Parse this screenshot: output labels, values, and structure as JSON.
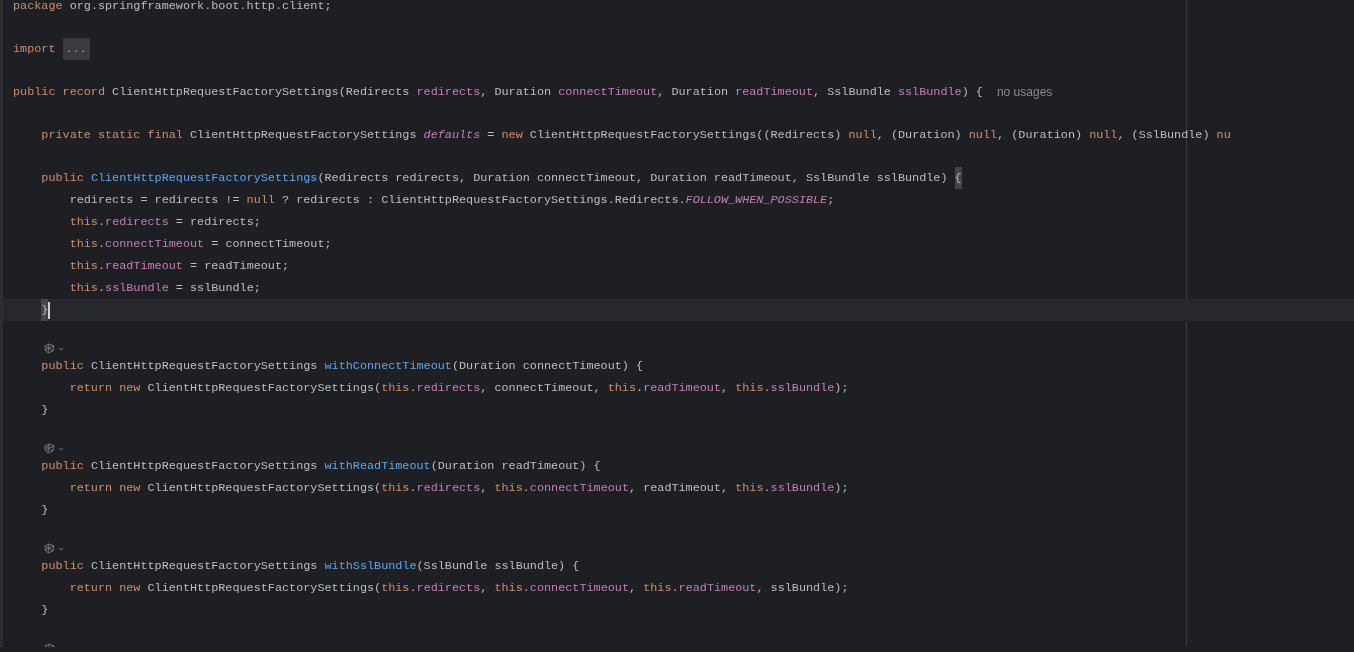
{
  "editor": {
    "lines": [
      {
        "kind": "code",
        "selected": false,
        "tokens": [
          {
            "kind": "kw",
            "text": "package"
          },
          {
            "kind": "plain",
            "text": " org.springframework.boot.http.client;"
          }
        ]
      },
      {
        "kind": "blank"
      },
      {
        "kind": "code",
        "selected": false,
        "tokens": [
          {
            "kind": "kw",
            "text": "import "
          },
          {
            "kind": "fold",
            "text": "..."
          }
        ]
      },
      {
        "kind": "blank"
      },
      {
        "kind": "code",
        "selected": false,
        "tokens": [
          {
            "kind": "kw",
            "text": "public record"
          },
          {
            "kind": "plain",
            "text": " ClientHttpRequestFactorySettings(Redirects "
          },
          {
            "kind": "field",
            "text": "redirects"
          },
          {
            "kind": "plain",
            "text": ", Duration "
          },
          {
            "kind": "field",
            "text": "connectTimeout"
          },
          {
            "kind": "plain",
            "text": ", Duration "
          },
          {
            "kind": "field",
            "text": "readTimeout"
          },
          {
            "kind": "plain",
            "text": ", SslBundle "
          },
          {
            "kind": "field",
            "text": "sslBundle"
          },
          {
            "kind": "plain",
            "text": ") {"
          },
          {
            "kind": "hint",
            "text": "no usages"
          }
        ],
        "children": [
          {
            "kind": "blank"
          },
          {
            "kind": "code",
            "selected": false,
            "tokens": [
              {
                "kind": "kw",
                "text": "private static final"
              },
              {
                "kind": "plain",
                "text": " ClientHttpRequestFactorySettings "
              },
              {
                "kind": "const",
                "text": "defaults"
              },
              {
                "kind": "plain",
                "text": " = "
              },
              {
                "kind": "kw",
                "text": "new"
              },
              {
                "kind": "plain",
                "text": " ClientHttpRequestFactorySettings((Redirects) "
              },
              {
                "kind": "kw",
                "text": "null"
              },
              {
                "kind": "plain",
                "text": ", (Duration) "
              },
              {
                "kind": "kw",
                "text": "null"
              },
              {
                "kind": "plain",
                "text": ", (Duration) "
              },
              {
                "kind": "kw",
                "text": "null"
              },
              {
                "kind": "plain",
                "text": ", (SslBundle) "
              },
              {
                "kind": "kw",
                "text": "nu"
              }
            ]
          },
          {
            "kind": "blank"
          },
          {
            "kind": "code",
            "selected": false,
            "tokens": [
              {
                "kind": "kw",
                "text": "public "
              },
              {
                "kind": "fn",
                "text": "ClientHttpRequestFactorySettings"
              },
              {
                "kind": "plain",
                "text": "(Redirects redirects, Duration connectTimeout, Duration readTimeout, SslBundle sslBundle) "
              },
              {
                "kind": "match",
                "text": "{"
              }
            ],
            "children": [
              {
                "kind": "code",
                "selected": false,
                "tokens": [
                  {
                    "kind": "plain",
                    "text": "redirects = redirects != "
                  },
                  {
                    "kind": "kw",
                    "text": "null"
                  },
                  {
                    "kind": "plain",
                    "text": " ? redirects : ClientHttpRequestFactorySettings.Redirects."
                  },
                  {
                    "kind": "const",
                    "text": "FOLLOW_WHEN_POSSIBLE"
                  },
                  {
                    "kind": "plain",
                    "text": ";"
                  }
                ]
              },
              {
                "kind": "code",
                "selected": false,
                "tokens": [
                  {
                    "kind": "kw",
                    "text": "this"
                  },
                  {
                    "kind": "plain",
                    "text": "."
                  },
                  {
                    "kind": "field",
                    "text": "redirects"
                  },
                  {
                    "kind": "plain",
                    "text": " = redirects;"
                  }
                ]
              },
              {
                "kind": "code",
                "selected": false,
                "tokens": [
                  {
                    "kind": "kw",
                    "text": "this"
                  },
                  {
                    "kind": "plain",
                    "text": "."
                  },
                  {
                    "kind": "field",
                    "text": "connectTimeout"
                  },
                  {
                    "kind": "plain",
                    "text": " = connectTimeout;"
                  }
                ]
              },
              {
                "kind": "code",
                "selected": false,
                "tokens": [
                  {
                    "kind": "kw",
                    "text": "this"
                  },
                  {
                    "kind": "plain",
                    "text": "."
                  },
                  {
                    "kind": "field",
                    "text": "readTimeout"
                  },
                  {
                    "kind": "plain",
                    "text": " = readTimeout;"
                  }
                ]
              },
              {
                "kind": "code",
                "selected": false,
                "tokens": [
                  {
                    "kind": "kw",
                    "text": "this"
                  },
                  {
                    "kind": "plain",
                    "text": "."
                  },
                  {
                    "kind": "field",
                    "text": "sslBundle"
                  },
                  {
                    "kind": "plain",
                    "text": " = sslBundle;"
                  }
                ]
              }
            ]
          },
          {
            "kind": "code",
            "selected": true,
            "tokens": [
              {
                "kind": "match",
                "text": "}"
              }
            ]
          },
          {
            "kind": "blank"
          },
          {
            "kind": "hint",
            "selected": false
          },
          {
            "kind": "code",
            "selected": false,
            "tokens": [
              {
                "kind": "kw",
                "text": "public"
              },
              {
                "kind": "plain",
                "text": " ClientHttpRequestFactorySettings "
              },
              {
                "kind": "fn",
                "text": "withConnectTimeout"
              },
              {
                "kind": "plain",
                "text": "(Duration connectTimeout) {"
              }
            ],
            "children": [
              {
                "kind": "code",
                "selected": false,
                "tokens": [
                  {
                    "kind": "kw",
                    "text": "return new"
                  },
                  {
                    "kind": "plain",
                    "text": " ClientHttpRequestFactorySettings("
                  },
                  {
                    "kind": "kw",
                    "text": "this"
                  },
                  {
                    "kind": "plain",
                    "text": "."
                  },
                  {
                    "kind": "field",
                    "text": "redirects"
                  },
                  {
                    "kind": "plain",
                    "text": ", connectTimeout, "
                  },
                  {
                    "kind": "kw",
                    "text": "this"
                  },
                  {
                    "kind": "plain",
                    "text": "."
                  },
                  {
                    "kind": "field",
                    "text": "readTimeout"
                  },
                  {
                    "kind": "plain",
                    "text": ", "
                  },
                  {
                    "kind": "kw",
                    "text": "this"
                  },
                  {
                    "kind": "plain",
                    "text": "."
                  },
                  {
                    "kind": "field",
                    "text": "sslBundle"
                  },
                  {
                    "kind": "plain",
                    "text": ");"
                  }
                ]
              }
            ]
          },
          {
            "kind": "code",
            "selected": false,
            "tokens": [
              {
                "kind": "plain",
                "text": "}"
              }
            ]
          },
          {
            "kind": "blank"
          },
          {
            "kind": "hint",
            "selected": false
          },
          {
            "kind": "code",
            "selected": false,
            "tokens": [
              {
                "kind": "kw",
                "text": "public"
              },
              {
                "kind": "plain",
                "text": " ClientHttpRequestFactorySettings "
              },
              {
                "kind": "fn",
                "text": "withReadTimeout"
              },
              {
                "kind": "plain",
                "text": "(Duration readTimeout) {"
              }
            ],
            "children": [
              {
                "kind": "code",
                "selected": false,
                "tokens": [
                  {
                    "kind": "kw",
                    "text": "return new"
                  },
                  {
                    "kind": "plain",
                    "text": " ClientHttpRequestFactorySettings("
                  },
                  {
                    "kind": "kw",
                    "text": "this"
                  },
                  {
                    "kind": "plain",
                    "text": "."
                  },
                  {
                    "kind": "field",
                    "text": "redirects"
                  },
                  {
                    "kind": "plain",
                    "text": ", "
                  },
                  {
                    "kind": "kw",
                    "text": "this"
                  },
                  {
                    "kind": "plain",
                    "text": "."
                  },
                  {
                    "kind": "field",
                    "text": "connectTimeout"
                  },
                  {
                    "kind": "plain",
                    "text": ", readTimeout, "
                  },
                  {
                    "kind": "kw",
                    "text": "this"
                  },
                  {
                    "kind": "plain",
                    "text": "."
                  },
                  {
                    "kind": "field",
                    "text": "sslBundle"
                  },
                  {
                    "kind": "plain",
                    "text": ");"
                  }
                ]
              }
            ]
          },
          {
            "kind": "code",
            "selected": false,
            "tokens": [
              {
                "kind": "plain",
                "text": "}"
              }
            ]
          },
          {
            "kind": "blank"
          },
          {
            "kind": "hint",
            "selected": false
          },
          {
            "kind": "code",
            "selected": false,
            "tokens": [
              {
                "kind": "kw",
                "text": "public"
              },
              {
                "kind": "plain",
                "text": " ClientHttpRequestFactorySettings "
              },
              {
                "kind": "fn",
                "text": "withSslBundle"
              },
              {
                "kind": "plain",
                "text": "(SslBundle sslBundle) {"
              }
            ],
            "children": [
              {
                "kind": "code",
                "selected": false,
                "tokens": [
                  {
                    "kind": "kw",
                    "text": "return new"
                  },
                  {
                    "kind": "plain",
                    "text": " ClientHttpRequestFactorySettings("
                  },
                  {
                    "kind": "kw",
                    "text": "this"
                  },
                  {
                    "kind": "plain",
                    "text": "."
                  },
                  {
                    "kind": "field",
                    "text": "redirects"
                  },
                  {
                    "kind": "plain",
                    "text": ", "
                  },
                  {
                    "kind": "kw",
                    "text": "this"
                  },
                  {
                    "kind": "plain",
                    "text": "."
                  },
                  {
                    "kind": "field",
                    "text": "connectTimeout"
                  },
                  {
                    "kind": "plain",
                    "text": ", "
                  },
                  {
                    "kind": "kw",
                    "text": "this"
                  },
                  {
                    "kind": "plain",
                    "text": "."
                  },
                  {
                    "kind": "field",
                    "text": "readTimeout"
                  },
                  {
                    "kind": "plain",
                    "text": ", sslBundle);"
                  }
                ]
              }
            ]
          },
          {
            "kind": "code",
            "selected": false,
            "tokens": [
              {
                "kind": "plain",
                "text": "}"
              }
            ]
          },
          {
            "kind": "blank"
          },
          {
            "kind": "hint",
            "selected": false
          }
        ]
      }
    ]
  }
}
